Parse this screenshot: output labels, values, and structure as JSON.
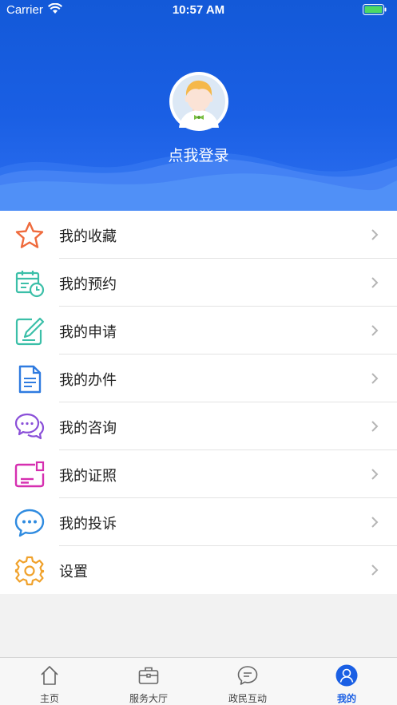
{
  "status_bar": {
    "carrier": "Carrier",
    "time": "10:57 AM"
  },
  "profile": {
    "login_label": "点我登录"
  },
  "menu": {
    "items": [
      {
        "label": "我的收藏",
        "icon": "star-icon"
      },
      {
        "label": "我的预约",
        "icon": "calendar-clock-icon"
      },
      {
        "label": "我的申请",
        "icon": "pen-square-icon"
      },
      {
        "label": "我的办件",
        "icon": "document-icon"
      },
      {
        "label": "我的咨询",
        "icon": "chat-bubbles-icon"
      },
      {
        "label": "我的证照",
        "icon": "id-card-icon"
      },
      {
        "label": "我的投诉",
        "icon": "speech-bubble-icon"
      },
      {
        "label": "设置",
        "icon": "gear-icon"
      }
    ]
  },
  "tabbar": {
    "tabs": [
      {
        "label": "主页",
        "icon": "home-icon"
      },
      {
        "label": "服务大厅",
        "icon": "briefcase-icon"
      },
      {
        "label": "政民互动",
        "icon": "chat-icon"
      },
      {
        "label": "我的",
        "icon": "user-icon"
      }
    ],
    "active_index": 3
  },
  "colors": {
    "header": "#1a5fe4",
    "active_tab": "#1a5fe4",
    "background": "#f2f2f2"
  }
}
